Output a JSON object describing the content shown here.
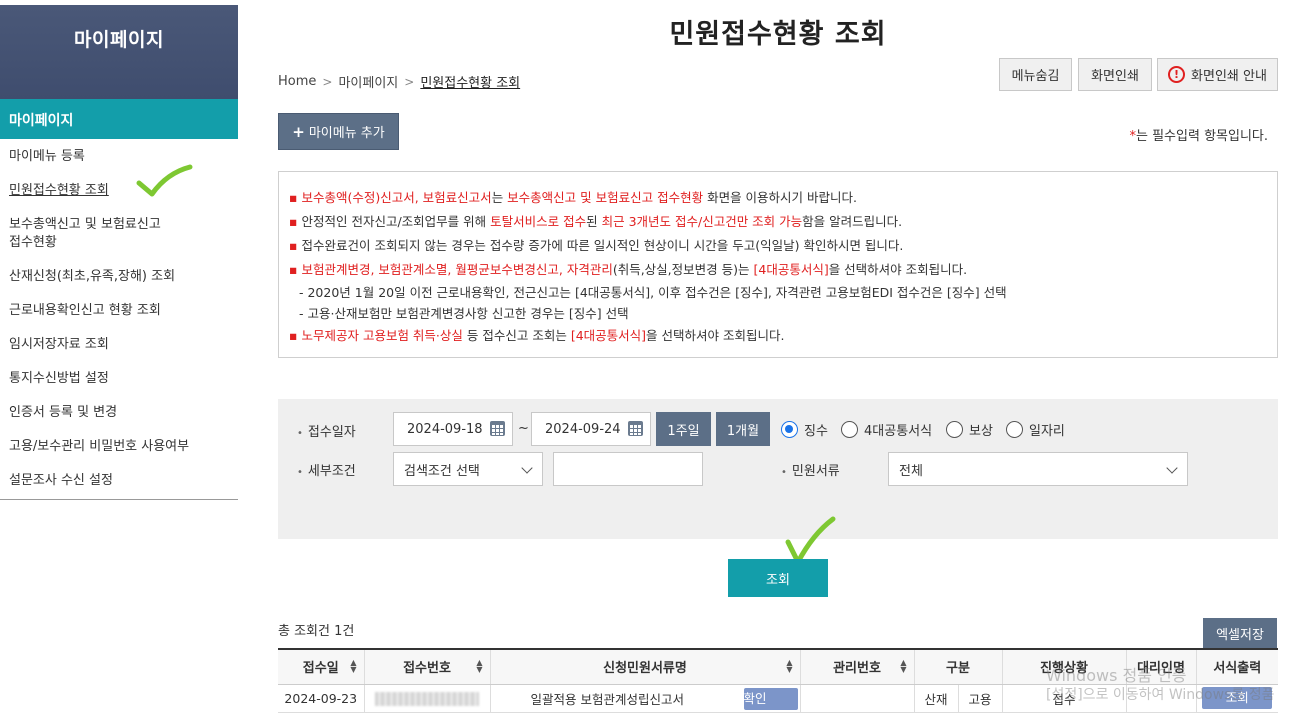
{
  "sidebar": {
    "title": "마이페이지",
    "section": "마이페이지",
    "items": [
      {
        "label": "마이메뉴 등록"
      },
      {
        "label": "민원접수현황 조회"
      },
      {
        "label_line1": "보수총액신고 및 보험료신고",
        "label_line2": "접수현황"
      },
      {
        "label": "산재신청(최초,유족,장해) 조회"
      },
      {
        "label": "근로내용확인신고 현황 조회"
      },
      {
        "label": "임시저장자료 조회"
      },
      {
        "label": "통지수신방법 설정"
      },
      {
        "label": "인증서 등록 및 변경"
      },
      {
        "label": "고용/보수관리 비밀번호 사용여부"
      },
      {
        "label": "설문조사 수신 설정"
      }
    ]
  },
  "header": {
    "title": "민원접수현황 조회",
    "breadcrumb": [
      "Home",
      "마이페이지",
      "민원접수현황 조회"
    ],
    "btn_hide_menu": "메뉴숨김",
    "btn_print": "화면인쇄",
    "btn_print_guide": "화면인쇄 안내",
    "btn_add_mymenu": "마이메뉴 추가",
    "required_star": "*",
    "required_note": "는 필수입력 항목입니다."
  },
  "notice": {
    "l1_a": "보수총액(수정)신고서, 보험료신고서",
    "l1_b": "는 ",
    "l1_c": "보수총액신고 및 보험료신고 접수현황",
    "l1_d": " 화면을 이용하시기 바랍니다.",
    "l2_a": "안정적인 전자신고/조회업무를 위해 ",
    "l2_b": "토탈서비스로 접수",
    "l2_c": "된 ",
    "l2_d": "최근 3개년도 접수/신고건만 조회 가능",
    "l2_e": "함을 알려드립니다.",
    "l3": "접수완료건이 조회되지 않는 경우는 접수량 증가에 따른 일시적인 현상이니 시간을 두고(익일날) 확인하시면 됩니다.",
    "l4_a": "보험관계변경, 보험관계소멸, 월평균보수변경신고, 자격관리",
    "l4_b": "(취득,상실,정보변경 등)는 ",
    "l4_c": "[4대공통서식]",
    "l4_d": "을 선택하셔야 조회됩니다.",
    "l4_sub1": "- 2020년 1월 20일 이전 근로내용확인, 전근신고는 [4대공통서식], 이후 접수건은 [징수], 자격관련 고용보험EDI 접수건은 [징수] 선택",
    "l4_sub2": "- 고용·산재보험만 보험관계변경사항 신고한 경우는 [징수] 선택",
    "l5_a": "노무제공자 고용보험 취득·상실",
    "l5_b": " 등 접수신고 조회는 ",
    "l5_c": "[4대공통서식]",
    "l5_d": "을 선택하셔야 조회됩니다."
  },
  "search": {
    "date_label": "접수일자",
    "date_from": "2024-09-18",
    "tilde": "~",
    "date_to": "2024-09-24",
    "btn_week": "1주일",
    "btn_month": "1개월",
    "radios": [
      {
        "label": "징수",
        "checked": true
      },
      {
        "label": "4대공통서식",
        "checked": false
      },
      {
        "label": "보상",
        "checked": false
      },
      {
        "label": "일자리",
        "checked": false
      }
    ],
    "detail_label": "세부조건",
    "detail_select": "검색조건 선택",
    "detail_input": "",
    "doc_label": "민원서류",
    "doc_select": "전체",
    "btn_search": "조회"
  },
  "results": {
    "total": "총 조회건 1건",
    "btn_excel": "엑셀저장",
    "columns": [
      "접수일",
      "접수번호",
      "신청민원서류명",
      "관리번호",
      "구분",
      "진행상황",
      "대리인명",
      "서식출력"
    ],
    "rows": [
      {
        "date": "2024-09-23",
        "doc_name": "일괄적용 보험관계성립신고서",
        "btn_confirm": "확인",
        "type1": "산재",
        "type2": "고용",
        "status": "접수",
        "btn_print": "조회"
      }
    ]
  },
  "watermark": {
    "line1": "Windows 정품 인증",
    "line2": "[설정]으로 이동하여 Windows를 정품"
  },
  "colors": {
    "teal": "#139eaa",
    "navy": "#4a5878",
    "slate_button": "#5c6f87",
    "red_text": "#e02020",
    "check_mark": "#7ec832"
  }
}
